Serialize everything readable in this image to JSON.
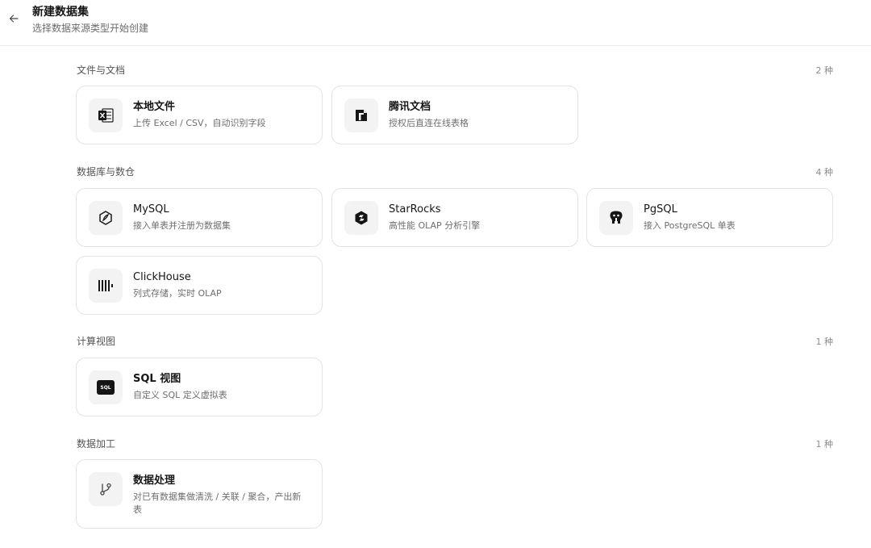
{
  "header": {
    "title": "新建数据集",
    "subtitle": "选择数据来源类型开始创建"
  },
  "sections": [
    {
      "label": "文件与文档",
      "count": "2 种",
      "cards": [
        {
          "name": "本地文件",
          "desc": "上传 Excel / CSV，自动识别字段",
          "icon": "excel-icon"
        },
        {
          "name": "腾讯文档",
          "desc": "授权后直连在线表格",
          "icon": "tencent-docs-icon"
        }
      ]
    },
    {
      "label": "数据库与数仓",
      "count": "4 种",
      "cards": [
        {
          "name": "MySQL",
          "desc": "接入单表并注册为数据集",
          "icon": "mysql-icon"
        },
        {
          "name": "StarRocks",
          "desc": "高性能 OLAP 分析引擎",
          "icon": "starrocks-icon"
        },
        {
          "name": "PgSQL",
          "desc": "接入 PostgreSQL 单表",
          "icon": "postgresql-icon"
        },
        {
          "name": "ClickHouse",
          "desc": "列式存储，实时 OLAP",
          "icon": "clickhouse-icon"
        }
      ]
    },
    {
      "label": "计算视图",
      "count": "1 种",
      "cards": [
        {
          "name": "SQL 视图",
          "desc": "自定义 SQL 定义虚拟表",
          "icon": "sql-icon",
          "icon_text": "SQL"
        }
      ]
    },
    {
      "label": "数据加工",
      "count": "1 种",
      "cards": [
        {
          "name": "数据处理",
          "desc": "对已有数据集做清洗 / 关联 / 聚合，产出新表",
          "icon": "branch-icon"
        }
      ]
    }
  ]
}
